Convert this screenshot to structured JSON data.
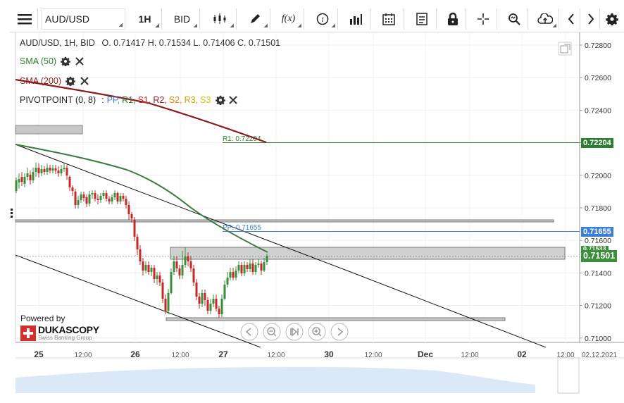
{
  "toolbar": {
    "symbol": "AUD/USD",
    "interval": "1H",
    "side": "BID",
    "menu_icon": "hamburger-icon",
    "icons": [
      "candlestick-icon",
      "pen-icon",
      "function-icon",
      "info-icon",
      "bar-chart-icon",
      "calendar-icon",
      "notes-icon",
      "lock-icon",
      "crosshair-icon",
      "zoom-icon",
      "cloud-upload-icon",
      "chevron-left-icon",
      "chevron-right-icon",
      "gear-icon"
    ],
    "fx_label": "f(x)"
  },
  "header": {
    "instrument": "AUD/USD, 1H, BID",
    "ohlc": "O. 0.71417 H. 0.71534 L. 0.71406 C. 0.71501"
  },
  "legend": {
    "sma50": "SMA (50)",
    "sma200": "SMA (200)",
    "pivot": "PIVOTPOINT (0, 8)",
    "pivot_sep": ":",
    "pivot_items": [
      {
        "text": "PP,",
        "color": "#3a7fd5"
      },
      {
        "text": "R1,",
        "color": "#2e7d32"
      },
      {
        "text": "S1,",
        "color": "#c62828"
      },
      {
        "text": "R2,",
        "color": "#a01818"
      },
      {
        "text": "S2,",
        "color": "#ef8a00"
      },
      {
        "text": "R3,",
        "color": "#d4a000"
      },
      {
        "text": "S3",
        "color": "#e0c000"
      }
    ],
    "sma50_color": "#2e7d32",
    "sma200_color": "#8b1a1a"
  },
  "levels": {
    "r1_label": "R1: 0.72204",
    "pp_label": "PP: 0.71655",
    "r1_tag": "0.72204",
    "pp_tag": "0.71655",
    "last_tag": "0.71501",
    "hidden_tag": "0.71533"
  },
  "y_axis": [
    "0.72800",
    "0.72600",
    "0.72400",
    "0.72200",
    "0.72000",
    "0.71800",
    "0.71600",
    "0.71400",
    "0.71200",
    "0.71000"
  ],
  "x_axis": [
    {
      "t": "25",
      "b": true
    },
    {
      "t": "12:00",
      "b": false
    },
    {
      "t": "26",
      "b": true
    },
    {
      "t": "12:00",
      "b": false
    },
    {
      "t": "27",
      "b": true
    },
    {
      "t": "12:00",
      "b": false
    },
    {
      "t": "30",
      "b": true
    },
    {
      "t": "12:00",
      "b": false
    },
    {
      "t": "Dec",
      "b": true
    },
    {
      "t": "12:00",
      "b": false
    },
    {
      "t": "02",
      "b": true
    },
    {
      "t": "12:00",
      "b": false
    },
    {
      "t": "02.12.2021",
      "b": false
    }
  ],
  "branding": {
    "powered_by": "Powered by",
    "name": "DUKASCOPY",
    "sub": "Swiss Banking Group"
  },
  "nav_icons": [
    "scroll-left-icon",
    "zoom-out-icon",
    "reset-icon",
    "zoom-in-icon",
    "scroll-right-icon"
  ],
  "colors": {
    "up": "#3a8f3a",
    "down": "#c62828",
    "r1": "#2e7d32",
    "pp": "#3a7fd5",
    "last": "#3a8f3a"
  }
}
